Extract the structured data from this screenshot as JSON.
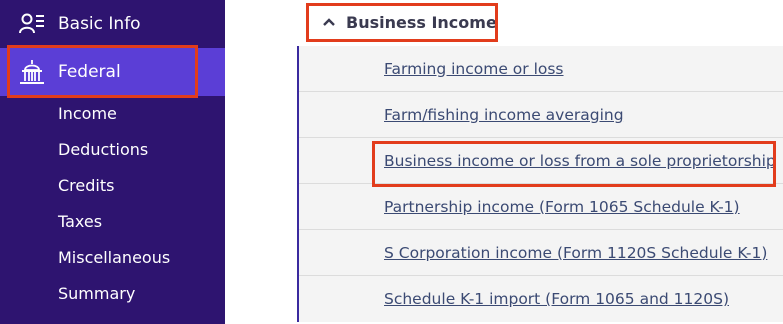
{
  "sidebar": {
    "basic_info": {
      "label": "Basic Info",
      "icon": "person-list-icon"
    },
    "federal": {
      "label": "Federal",
      "icon": "capitol-building-icon"
    },
    "sub_items": [
      "Income",
      "Deductions",
      "Credits",
      "Taxes",
      "Miscellaneous",
      "Summary"
    ]
  },
  "section": {
    "title": "Business Income",
    "icon": "chevron-up-icon",
    "links": [
      "Farming income or loss",
      "Farm/fishing income averaging",
      "Business income or loss from a sole proprietorship",
      "Partnership income (Form 1065 Schedule K-1)",
      "S Corporation income (Form 1120S Schedule K-1)",
      "Schedule K-1 import (Form 1065 and 1120S)"
    ]
  },
  "colors": {
    "sidebar_bg": "#2e1470",
    "active_bg": "#5b3ed6",
    "highlight": "#e23c1c",
    "link": "#3b4a73"
  }
}
